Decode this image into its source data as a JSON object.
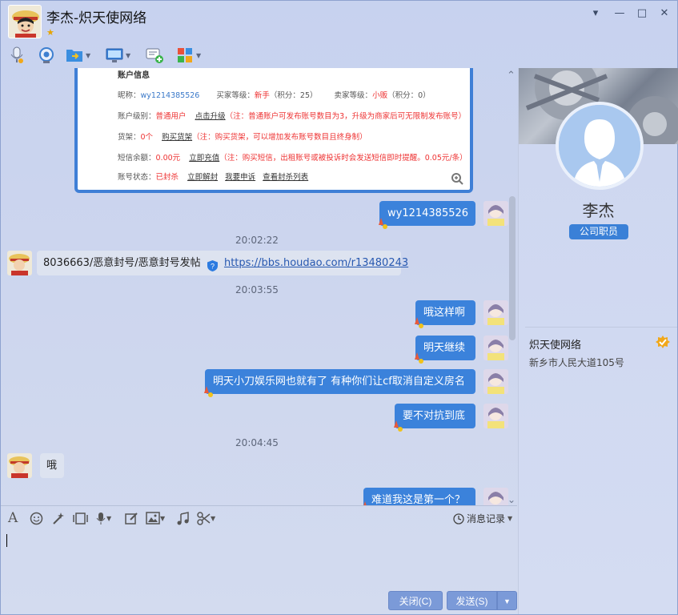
{
  "window": {
    "title": "李杰-炽天使网络",
    "controls": {
      "menu": "▾",
      "minimize": "—",
      "maximize": "□",
      "close": "✕"
    }
  },
  "toolbar": {
    "items": [
      "microphone-icon",
      "video-icon",
      "file-transfer-icon",
      "screen-share-icon",
      "add-app-icon",
      "apps-grid-icon"
    ]
  },
  "screenshot_card": {
    "header": "账户信息",
    "rows": [
      {
        "label": "昵称：",
        "value": "wy1214385526",
        "extra1": "买家等级：",
        "extra1_value": "新手",
        "extra1_note": "（积分：25）",
        "extra2": "卖家等级：",
        "extra2_value": "小贩",
        "extra2_note": "（积分：0）"
      },
      {
        "label": "账户级别：",
        "value": "普通用户",
        "link": "点击升级",
        "note": "（注：普通账户可发布账号数目为3，升级为商家后可无限制发布账号）"
      },
      {
        "label": "货架：",
        "value": "0个",
        "link": "购买货架",
        "note": "（注：购买货架，可以增加发布账号数目且终身制）"
      },
      {
        "label": "短信余额：",
        "value": "0.00元",
        "link": "立即充值",
        "note": "（注：购买短信，出租账号或被投诉时会发送短信即时提醒。0.05元/条）"
      },
      {
        "label": "账号状态：",
        "value": "已封杀",
        "link": "立即解封",
        "link2": "我要申诉",
        "link3": "查看封杀列表"
      }
    ]
  },
  "messages": [
    {
      "side": "right",
      "text": "wy1214385526"
    },
    {
      "type": "time",
      "text": "20:02:22"
    },
    {
      "side": "left",
      "text": "8036663/恶意封号/恶意封号发帖",
      "link": "https://bbs.houdao.com/r13480243"
    },
    {
      "type": "time",
      "text": "20:03:55"
    },
    {
      "side": "right",
      "text": "哦这样啊"
    },
    {
      "side": "right",
      "text": "明天继续"
    },
    {
      "side": "right",
      "text": "明天小刀娱乐网也就有了 有种你们让cf取消自定义房名"
    },
    {
      "side": "right",
      "text": "要不对抗到底"
    },
    {
      "type": "time",
      "text": "20:04:45"
    },
    {
      "side": "left",
      "text": "哦"
    },
    {
      "side": "right",
      "text": "难道我这是第一个？"
    }
  ],
  "input": {
    "history_label": "消息记录",
    "close_button": "关闭(C)",
    "send_button": "发送(S)"
  },
  "profile": {
    "name": "李杰",
    "role": "公司职员",
    "company": "炽天使网络",
    "address": "新乡市人民大道105号"
  },
  "colors": {
    "accent": "#3b82db",
    "danger": "#e33333"
  }
}
